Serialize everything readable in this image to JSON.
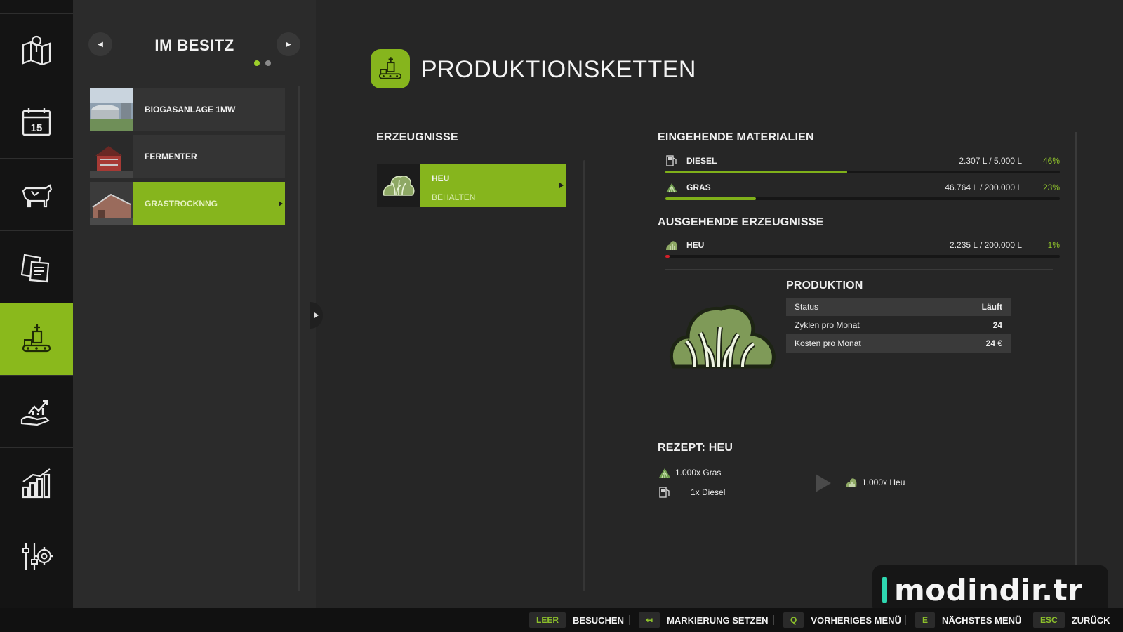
{
  "nav": {
    "items": [
      {
        "name": "map",
        "icon": "map-pin-icon"
      },
      {
        "name": "calendar",
        "icon": "calendar-icon",
        "day": "15"
      },
      {
        "name": "animals",
        "icon": "cow-icon"
      },
      {
        "name": "contracts",
        "icon": "documents-icon"
      },
      {
        "name": "production",
        "icon": "production-chain-icon",
        "active": true
      },
      {
        "name": "finances",
        "icon": "money-growth-icon"
      },
      {
        "name": "statistics",
        "icon": "bar-chart-icon"
      },
      {
        "name": "settings",
        "icon": "settings-sliders-icon"
      }
    ]
  },
  "owned": {
    "title": "IM BESITZ",
    "prev_icon": "chevron-left-icon",
    "next_icon": "chevron-right-icon",
    "page_dots": 2,
    "current_page": 1,
    "items": [
      {
        "label": "BIOGASANLAGE 1MW"
      },
      {
        "label": "FERMENTER"
      },
      {
        "label": "GRASTROCKNNG",
        "selected": true
      }
    ]
  },
  "main": {
    "title": "PRODUKTIONSKETTEN",
    "products_heading": "ERZEUGNISSE",
    "product": {
      "name": "HEU",
      "mode": "BEHALTEN"
    },
    "incoming_heading": "EINGEHENDE MATERIALIEN",
    "incoming": [
      {
        "name": "DIESEL",
        "amount": "2.307 L / 5.000 L",
        "percent": "46%",
        "fill": 0.46,
        "icon": "diesel-pump-icon"
      },
      {
        "name": "GRAS",
        "amount": "46.764 L / 200.000 L",
        "percent": "23%",
        "fill": 0.23,
        "icon": "grass-icon"
      }
    ],
    "outgoing_heading": "AUSGEHENDE ERZEUGNISSE",
    "outgoing": [
      {
        "name": "HEU",
        "amount": "2.235 L / 200.000 L",
        "percent": "1%",
        "fill": 0.01,
        "icon": "hay-icon"
      }
    ],
    "production_heading": "PRODUKTION",
    "production_rows": [
      {
        "label": "Status",
        "value": "Läuft"
      },
      {
        "label": "Zyklen pro Monat",
        "value": "24"
      },
      {
        "label": "Kosten pro Monat",
        "value": "24 €"
      }
    ],
    "recipe_heading": "REZEPT: HEU",
    "recipe_inputs": [
      "1.000x Gras",
      "1x Diesel"
    ],
    "recipe_output": "1.000x Heu"
  },
  "watermark": {
    "text": "modindir.tr"
  },
  "bottom_bar": [
    {
      "key": "LEER",
      "label": "BESUCHEN"
    },
    {
      "key": "↤",
      "label": "MARKIERUNG SETZEN"
    },
    {
      "key": "Q",
      "label": "VORHERIGES MENÜ"
    },
    {
      "key": "E",
      "label": "NÄCHSTES MENÜ"
    },
    {
      "key": "ESC",
      "label": "ZURÜCK"
    }
  ],
  "colors": {
    "accent": "#86b51d",
    "bar_fill": "#7fb01a",
    "bar_low": "#d2202a",
    "percent": "#8fc22b"
  }
}
